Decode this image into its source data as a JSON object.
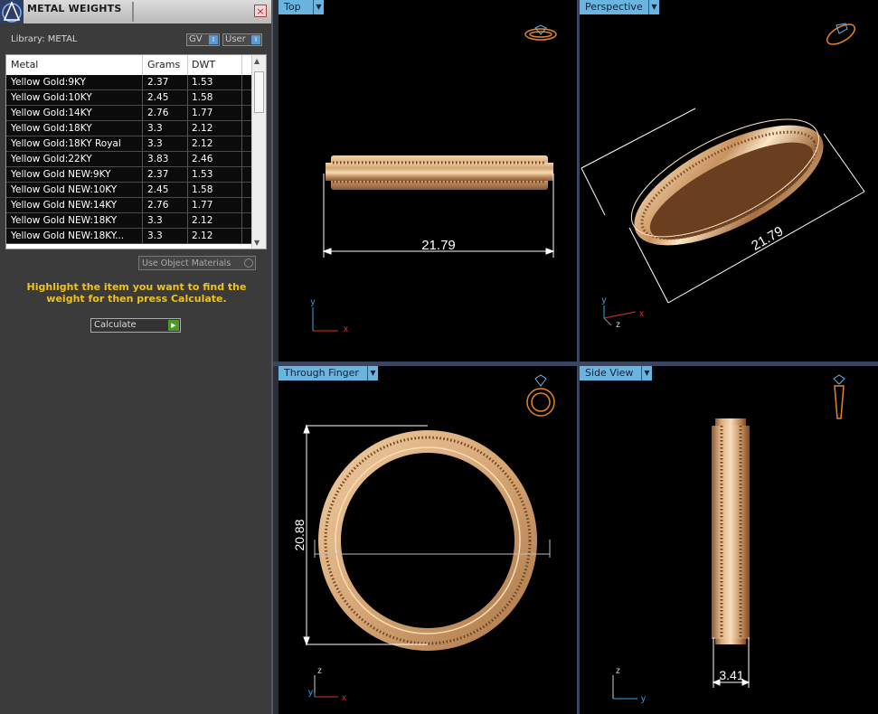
{
  "panel": {
    "title": "METAL WEIGHTS",
    "close_label": "×",
    "library": "Library: METAL",
    "toggle_gv": "GV",
    "toggle_user": "User",
    "columns": [
      "Metal",
      "Grams",
      "DWT"
    ],
    "rows": [
      {
        "metal": "Yellow Gold:9KY",
        "grams": "2.37",
        "dwt": "1.53"
      },
      {
        "metal": "Yellow Gold:10KY",
        "grams": "2.45",
        "dwt": "1.58"
      },
      {
        "metal": "Yellow Gold:14KY",
        "grams": "2.76",
        "dwt": "1.77"
      },
      {
        "metal": "Yellow Gold:18KY",
        "grams": "3.3",
        "dwt": "2.12"
      },
      {
        "metal": "Yellow Gold:18KY Royal",
        "grams": "3.3",
        "dwt": "2.12"
      },
      {
        "metal": "Yellow Gold:22KY",
        "grams": "3.83",
        "dwt": "2.46"
      },
      {
        "metal": "Yellow Gold NEW:9KY",
        "grams": "2.37",
        "dwt": "1.53"
      },
      {
        "metal": "Yellow Gold NEW:10KY",
        "grams": "2.45",
        "dwt": "1.58"
      },
      {
        "metal": "Yellow Gold NEW:14KY",
        "grams": "2.76",
        "dwt": "1.77"
      },
      {
        "metal": "Yellow Gold NEW:18KY",
        "grams": "3.3",
        "dwt": "2.12"
      },
      {
        "metal": "Yellow Gold NEW:18KY...",
        "grams": "3.3",
        "dwt": "2.12"
      }
    ],
    "use_object_materials": "Use Object Materials",
    "hint": "Highlight the item you want to find the weight for then press Calculate.",
    "calculate": "Calculate"
  },
  "viewports": {
    "top": {
      "label": "Top",
      "dimension": "21.79"
    },
    "perspective": {
      "label": "Perspective",
      "dimension": "21.79"
    },
    "through_finger": {
      "label": "Through Finger",
      "dimension": "20.88"
    },
    "side_view": {
      "label": "Side View",
      "dimension": "3.41"
    }
  },
  "axes": {
    "x": "x",
    "y": "y",
    "z": "z"
  },
  "colors": {
    "gold": "#e2b98a",
    "gold_dark": "#8a5a36",
    "viewport_label": "#6ab5e0",
    "hint": "#f0c21a"
  }
}
